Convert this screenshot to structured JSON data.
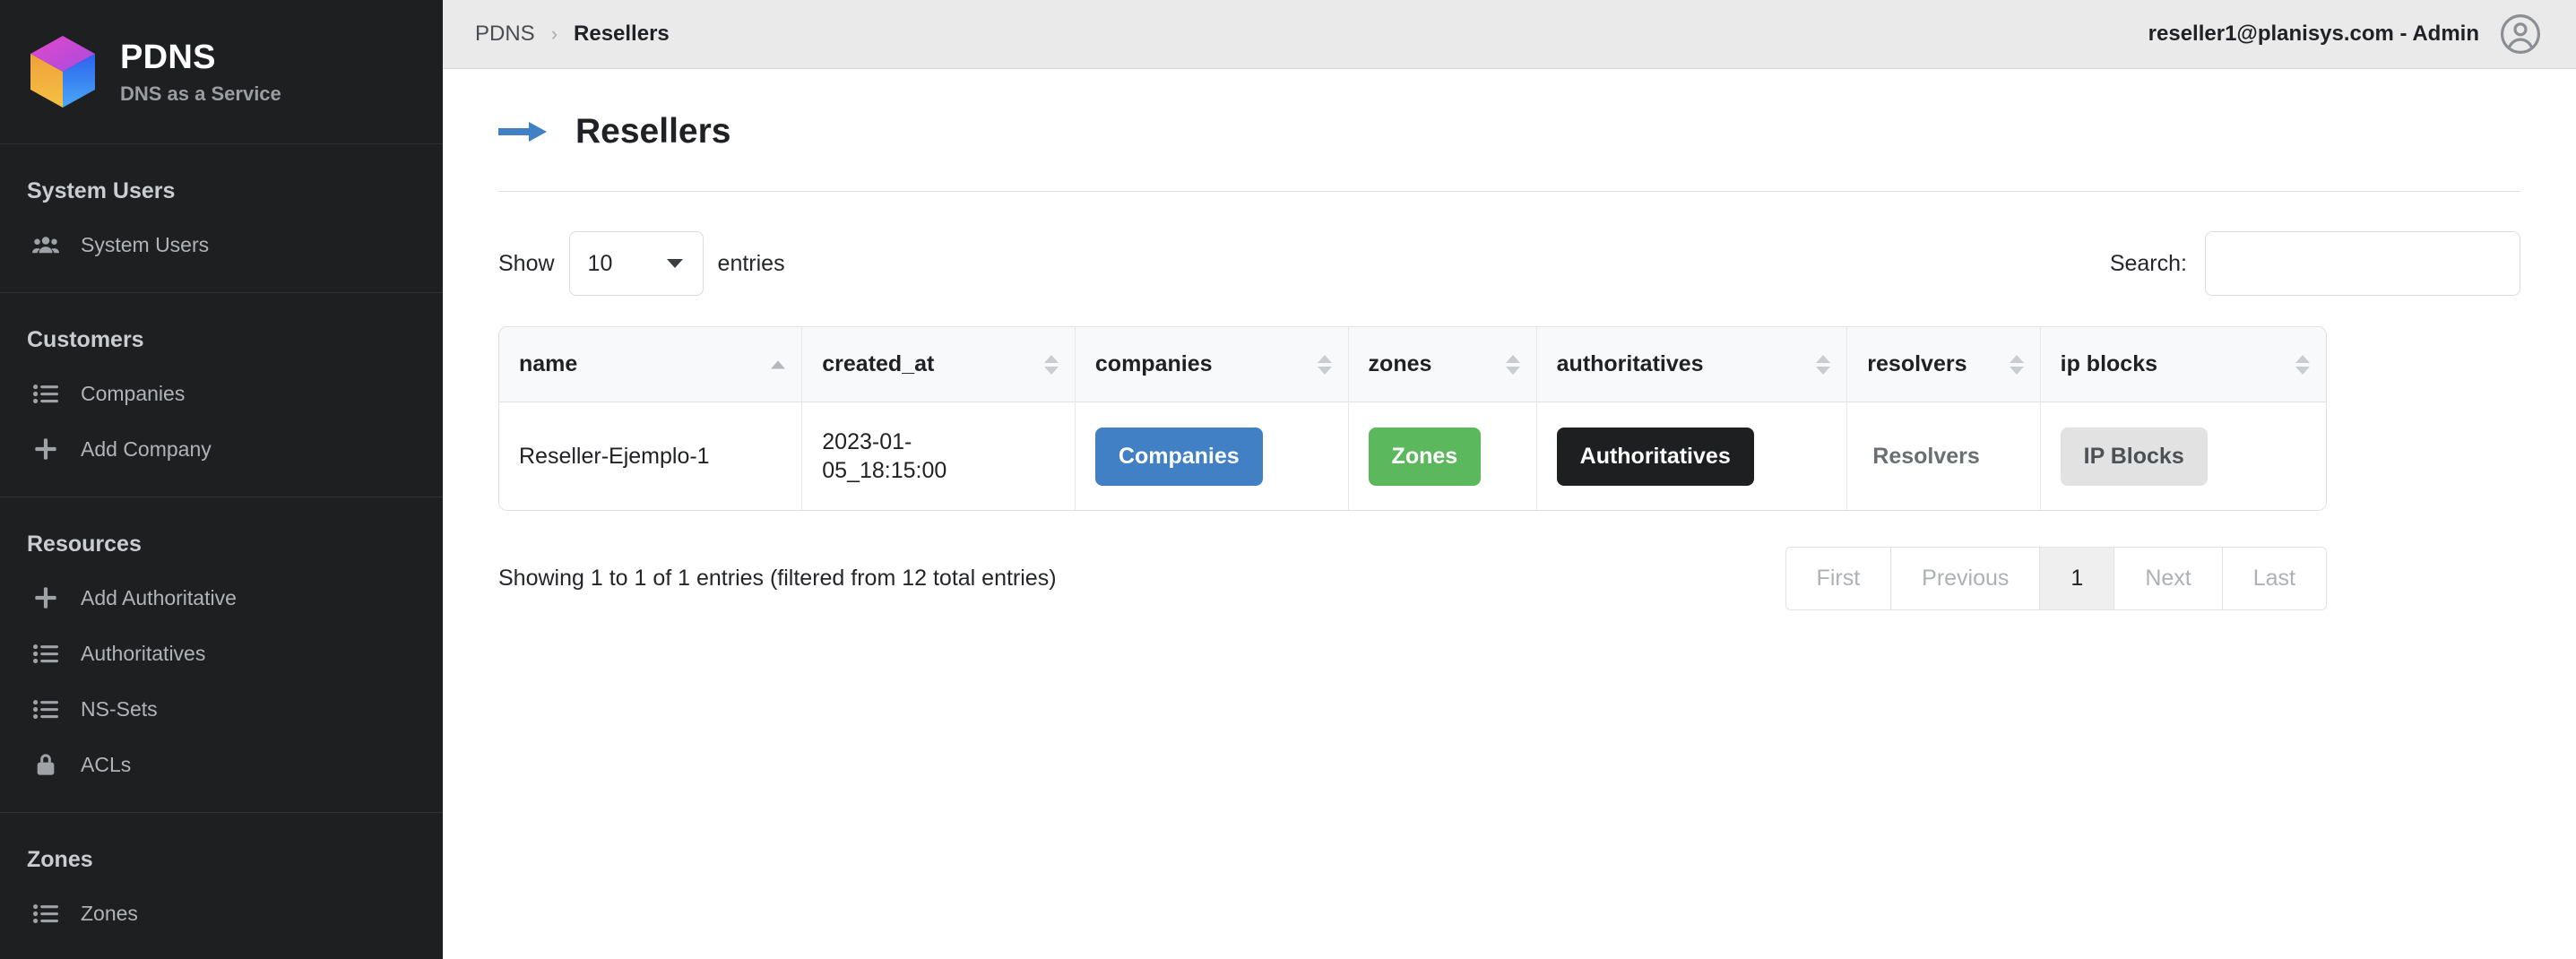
{
  "sidebar": {
    "brand": {
      "title": "PDNS",
      "subtitle": "DNS as a Service",
      "logo_icon": "hexagon-cube-logo"
    },
    "sections": [
      {
        "title": "System Users",
        "items": [
          {
            "label": "System Users",
            "icon": "users-group-icon"
          }
        ]
      },
      {
        "title": "Customers",
        "items": [
          {
            "label": "Companies",
            "icon": "list-icon"
          },
          {
            "label": "Add Company",
            "icon": "plus-icon"
          }
        ]
      },
      {
        "title": "Resources",
        "items": [
          {
            "label": "Add Authoritative",
            "icon": "plus-icon"
          },
          {
            "label": "Authoritatives",
            "icon": "list-icon"
          },
          {
            "label": "NS-Sets",
            "icon": "list-icon"
          },
          {
            "label": "ACLs",
            "icon": "lock-icon"
          }
        ]
      },
      {
        "title": "Zones",
        "items": [
          {
            "label": "Zones",
            "icon": "list-icon"
          }
        ]
      }
    ]
  },
  "topbar": {
    "breadcrumb_root": "PDNS",
    "breadcrumb_separator": "›",
    "breadcrumb_current": "Resellers",
    "user_label": "reseller1@planisys.com - Admin",
    "avatar_icon": "user-circle-icon"
  },
  "page": {
    "title": "Resellers",
    "title_icon": "arrow-right-icon"
  },
  "controls": {
    "show_label": "Show",
    "entries_label": "entries",
    "page_length": "10",
    "search_label": "Search:",
    "search_value": "",
    "search_placeholder": ""
  },
  "table": {
    "columns": [
      {
        "label": "name",
        "sort": "asc"
      },
      {
        "label": "created_at",
        "sort": "none"
      },
      {
        "label": "companies",
        "sort": "none"
      },
      {
        "label": "zones",
        "sort": "none"
      },
      {
        "label": "authoritatives",
        "sort": "none"
      },
      {
        "label": "resolvers",
        "sort": "none"
      },
      {
        "label": "ip blocks",
        "sort": "none"
      }
    ],
    "rows": [
      {
        "name": "Reseller-Ejemplo-1",
        "created_at_line1": "2023-01-",
        "created_at_line2": "05_18:15:00",
        "companies_button": "Companies",
        "zones_button": "Zones",
        "authoritatives_button": "Authoritatives",
        "resolvers_button": "Resolvers",
        "ip_blocks_button": "IP Blocks"
      }
    ]
  },
  "footer": {
    "showing_info": "Showing 1 to 1 of 1 entries (filtered from 12 total entries)",
    "pagination": [
      {
        "label": "First",
        "active": false
      },
      {
        "label": "Previous",
        "active": false
      },
      {
        "label": "1",
        "active": true
      },
      {
        "label": "Next",
        "active": false
      },
      {
        "label": "Last",
        "active": false
      }
    ]
  },
  "colors": {
    "sidebar_bg": "#1d1f21",
    "topbar_bg": "#eaeaea",
    "accent_blue": "#4180c4",
    "accent_green": "#5cb85c",
    "dark_button": "#1d1f21",
    "light_button": "#e2e2e2"
  }
}
